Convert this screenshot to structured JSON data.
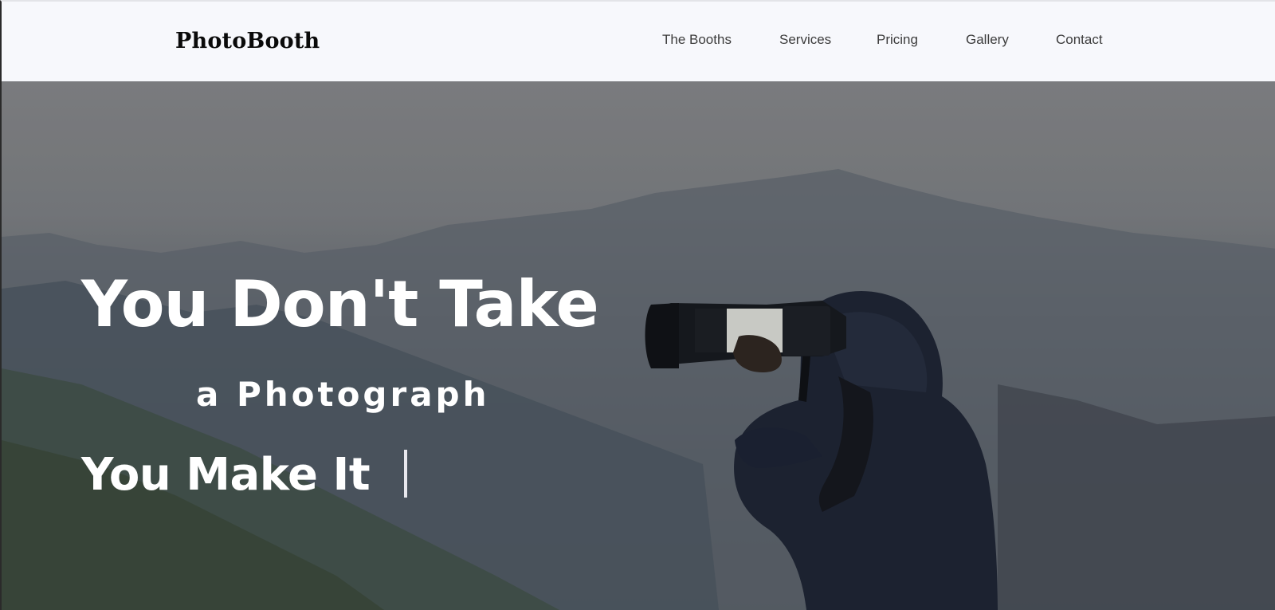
{
  "nav": {
    "brand": "PhotoBooth",
    "links": [
      "The Booths",
      "Services",
      "Pricing",
      "Gallery",
      "Contact"
    ]
  },
  "hero": {
    "headline": "You Don't Take",
    "subline": "a Photograph",
    "typed_text": "You Make It"
  },
  "colors": {
    "nav_background": "#f7f8fc",
    "brand_text": "#0a0a0a",
    "nav_text": "#3c3c3c",
    "hero_text": "#ffffff"
  }
}
